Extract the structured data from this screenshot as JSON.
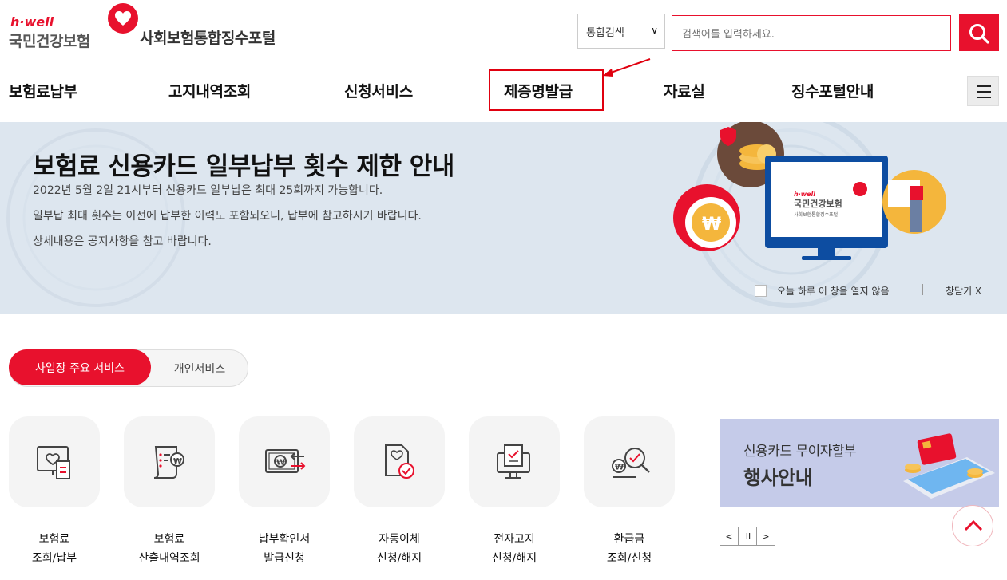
{
  "header": {
    "logo_hwell": "h·well",
    "logo_name": "국민건강보험",
    "portal_title": "사회보험통합징수포털",
    "search_scope": "통합검색",
    "search_placeholder": "검색어를 입력하세요."
  },
  "nav": {
    "items": [
      "보험료납부",
      "고지내역조회",
      "신청서비스",
      "제증명발급",
      "자료실",
      "징수포털안내"
    ],
    "highlighted": "제증명발급"
  },
  "banner": {
    "title": "보험료 신용카드 일부납부 횟수 제한 안내",
    "lines": [
      "2022년 5월 2일 21시부터 신용카드 일부납은 최대 25회까지 가능합니다.",
      "일부납 최대 횟수는 이전에 납부한 이력도 포함되오니, 납부에 참고하시기 바랍니다.",
      "상세내용은 공지사항을 참고 바랍니다."
    ],
    "monitor_logo": "국민건강보험",
    "monitor_hwell": "h·well",
    "monitor_sub": "사회보험통합징수포털",
    "dont_show_today": "오늘 하루 이 창을 열지 않음",
    "close_label": "창닫기 X"
  },
  "tabs": {
    "active": "사업장 주요 서비스",
    "inactive": "개인서비스"
  },
  "services": [
    {
      "line1": "보험료",
      "line2": "조회/납부",
      "icon": "invoice-heart-icon"
    },
    {
      "line1": "보험료",
      "line2": "산출내역조회",
      "icon": "calculation-scroll-icon"
    },
    {
      "line1": "납부확인서",
      "line2": "발급신청",
      "icon": "payment-transfer-icon"
    },
    {
      "line1": "자동이체",
      "line2": "신청/해지",
      "icon": "auto-transfer-icon"
    },
    {
      "line1": "전자고지",
      "line2": "신청/해지",
      "icon": "electronic-notice-icon"
    },
    {
      "line1": "환급금",
      "line2": "조회/신청",
      "icon": "refund-search-icon"
    }
  ],
  "promo": {
    "line1": "신용카드 무이자할부",
    "line2": "행사안내"
  },
  "carousel": {
    "prev": "<",
    "pause": "II",
    "next": ">"
  },
  "colors": {
    "brand_red": "#e8112d",
    "banner_bg": "#dde6ef",
    "promo_bg": "#c5cbe9"
  }
}
